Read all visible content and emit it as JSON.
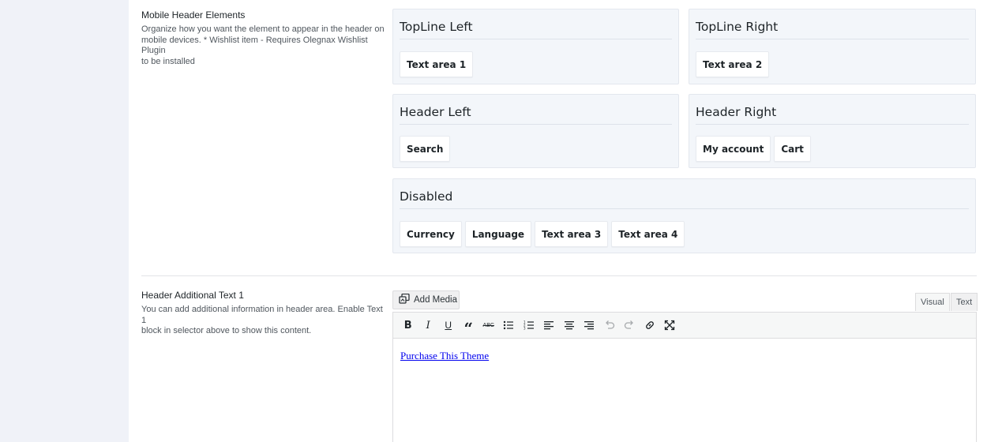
{
  "mobile_header": {
    "label": "Mobile Header Elements",
    "description_lines": [
      "Organize how you want the element to appear in the header on",
      "mobile devices. * Wishlist item - Requires Olegnax Wishlist Plugin",
      "to be installed"
    ],
    "boxes": {
      "topline_left": {
        "title": "TopLine Left",
        "items": [
          "Text area 1"
        ]
      },
      "topline_right": {
        "title": "TopLine Right",
        "items": [
          "Text area 2"
        ]
      },
      "header_left": {
        "title": "Header Left",
        "items": [
          "Search"
        ]
      },
      "header_right": {
        "title": "Header Right",
        "items": [
          "My account",
          "Cart"
        ]
      },
      "disabled": {
        "title": "Disabled",
        "items": [
          "Currency",
          "Language",
          "Text area 3",
          "Text area 4"
        ]
      }
    }
  },
  "additional_text": {
    "label": "Header Additional Text 1",
    "description_lines": [
      "You can add additional information in header area. Enable Text 1",
      "block in selector above to show this content."
    ],
    "add_media_label": "Add Media",
    "tabs": {
      "visual": "Visual",
      "text": "Text"
    },
    "toolbar_icons": [
      "bold-icon",
      "italic-icon",
      "underline-icon",
      "blockquote-icon",
      "strikethrough-icon",
      "bullet-list-icon",
      "numbered-list-icon",
      "align-left-icon",
      "align-center-icon",
      "align-right-icon",
      "undo-icon",
      "redo-icon",
      "link-icon",
      "fullscreen-icon"
    ],
    "content_link": "Purchase This Theme"
  },
  "colors": {
    "rail": "#f0f2f8",
    "box_bg": "#f3f6fa",
    "link": "#0000ee"
  }
}
